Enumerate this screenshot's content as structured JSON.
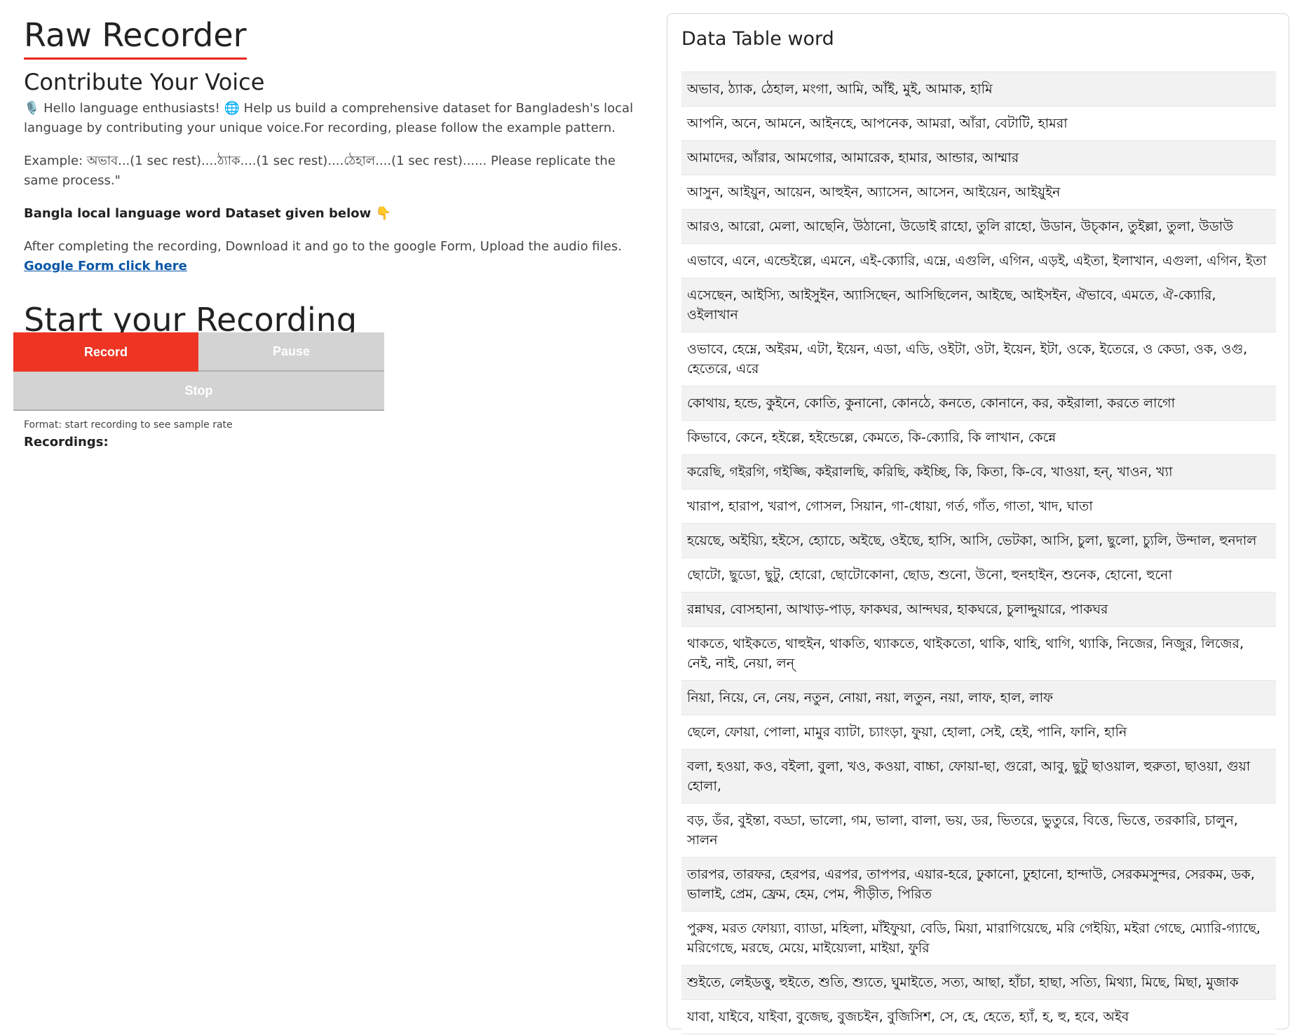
{
  "left": {
    "title": "Raw Recorder",
    "subtitle": "Contribute Your Voice",
    "intro": "🎙️ Hello language enthusiasts! 🌐 Help us build a comprehensive dataset for Bangladesh's local language by contributing your unique voice.For recording, please follow the example pattern.",
    "example": "Example: অভাব...(1 sec rest)....ঠ্যাক....(1 sec rest)....ঠেহাল....(1 sec rest)...... Please replicate the same process.\"",
    "dataset_note": "Bangla local language word Dataset given below 👇",
    "after_text": "After completing the recording, Download it and go to the google Form, Upload the audio files.",
    "form_link": "Google Form click here",
    "start_title": "Start your Recording"
  },
  "recorder": {
    "record_label": "Record",
    "pause_label": "Pause",
    "stop_label": "Stop",
    "format_note": "Format: start recording to see sample rate",
    "recordings_label": "Recordings:"
  },
  "panel": {
    "title": "Data Table word",
    "rows": [
      "অভাব, ঠ্যাক, ঠেহাল, মংগা, আমি, আঁই, মুই, আমাক, হামি",
      "আপনি, অনে, আমনে, আইনহে, আপনেক, আমরা, আঁরা, বেটাটি, হামরা",
      "আমাদের, আঁরার, আমগোর, আমারেক, হামার, আন্ডার, আম্মার",
      "আসুন, আইয়ুন, আয়েন, আহুইন, অ্যাসেন, আসেন, আইয়েন, আইয়ুইন",
      "আরও, আরো, মেলা, আছেনি, উঠানো, উডোই রাহো, তুলি রাহো, উডান, উচ্কান, তুইল্লা, তুলা, উডাউ",
      "এভাবে, এনে, এন্ডেইল্লে, এমনে, এই-ক্যোরি, এম্নে, এগুলি, এগিন, এড়ই, এইতা, ইলাখান, এগুলা, এগিন, ইতা",
      "এসেছেন, আইস্যি, আইসুইন, অ্যাসিছেন, আসিছিলেন, আইছে, আইসইন, ঐভাবে, এমতে, ঐ-ক্যোরি, ওইলাখান",
      "ওভাবে, হেম্নে, অইরম, এটা, ইয়েন, এডা, এডি, ওইটা, ওটা, ইয়েন, ইটা, ওকে, ইতেরে, ও কেডা, ওক, ওগু, হেতেরে, এরে",
      "কোথায়, হন্ডে, কুইনে, কোতি, কুনানো, কোনঠে, কনতে, কোনানে, কর, কইরালা, করতে লাগো",
      "কিভাবে, কেনে, হইল্লে, হইন্ডেল্লে, কেমতে, কি-ক্যোরি, কি লাখান, কেন্নে",
      "করেছি, গইরগি, গইজ্জি, কইরালছি, করিছি, কইচ্ছি, কি, কিতা, কি-বে, খাওয়া, হন্, খাওন, খ্যা",
      "খারাপ, হারাপ, খরাপ, গোসল, সিয়ান, গা-ধোয়া, গর্ত, গাঁত, গাতা, খাদ, ঘাতা",
      "হয়েছে, অইয়্যি, হইসে, হ্যোচে, অইছে, ওইছে, হাসি, আসি, ভেটকা, আসি, চুলা, ছুলো, চ্যুলি, উন্দাল, হুনদাল",
      "ছোটো, ছুডো, ছুটু, হোরো, ছোটোকোনা, ছোড, শুনো, উনো, হুনহাইন, শুনেক, হোনো, হুনো",
      "রন্নাঘর, বোসহানা, আখাড়-পাড়, ফাকঘর, আন্দঘর, হাকঘরে, চুলাদ্দুয়ারে, পাকঘর",
      "থাকতে, থাইকতে, থাহুইন, থাকতি, থ্যাকতে, থাইকতো, থাকি, থাহি, থাগি, থ্যাকি, নিজের, নিজুর, লিজের, নেই, নাই, নেয়া, লন্",
      "নিয়া, নিয়ে, নে, নেয়, নতুন, নোয়া, নয়া, লতুন, নয়া, লাফ, হাল, লাফ",
      "ছেলে, ফোয়া, পোলা, মামুর ব্যাটা, চ্যাংড়া, ফুয়া, হোলা, সেই, হেই, পানি, ফানি, হানি",
      "বলা, হওয়া, কও, বইলা, বুলা, খও, কওয়া, বাচ্চা, ফোয়া-ছা, গুরো, আবু, ছুটু ছাওয়াল, হুরুতা, ছাওয়া, গুয়া হোলা,",
      "বড়, ডঁর, বুইন্তা, বড্ডা, ভালো, গম, ভালা, বালা, ভয়, ডর, ভিতরে, ভুতুরে, বিত্তে, ভিত্তে, তরকারি, চালুন, সালন",
      "তারপর, তারফর, হেরপর, এরপর, তাপপর, এয়ার-হরে, ঢুকানো, ঢুহানো, হান্দাউ, সেরকমসুন্দর, সেরকম, ডক, ভালাই, প্রেম, ফ্রেম, হেম, পেম, পীড়ীত, পিরিত",
      "পুরুষ, মরত ফোয়্যা, ব্যাডা, মহিলা, মাঁইফুয়া, বেডি, মিয়া, মারাগিয়েছে, মরি গেইয়্যি, মইরা গেছে, ম্যোরি-গ্যাছে, মরিগেছে, মরছে, মেয়ে, মাইয়্যেলা, মাইয়া, ফুরি",
      "শুইতে, লেইডত্তু, হুইতে, শুতি, শ্যুতে, ঘুমাইতে, সত্য, আছা, হাঁচা, হাছা, সত্যি, মিথ্যা, মিছে, মিছা, মুজাক",
      "যাবা, যাইবে, যাইবা, বুজেছ, বুজচইন, বুজিসিশ, সে, হে, হেতে, হ্যাঁ, হ, হু, হবে, অইব"
    ]
  },
  "colors": {
    "record_button": "#ee3524",
    "disabled_button": "#d3d3d3",
    "link": "#0b57a6",
    "title_underline": "#e8271f"
  }
}
